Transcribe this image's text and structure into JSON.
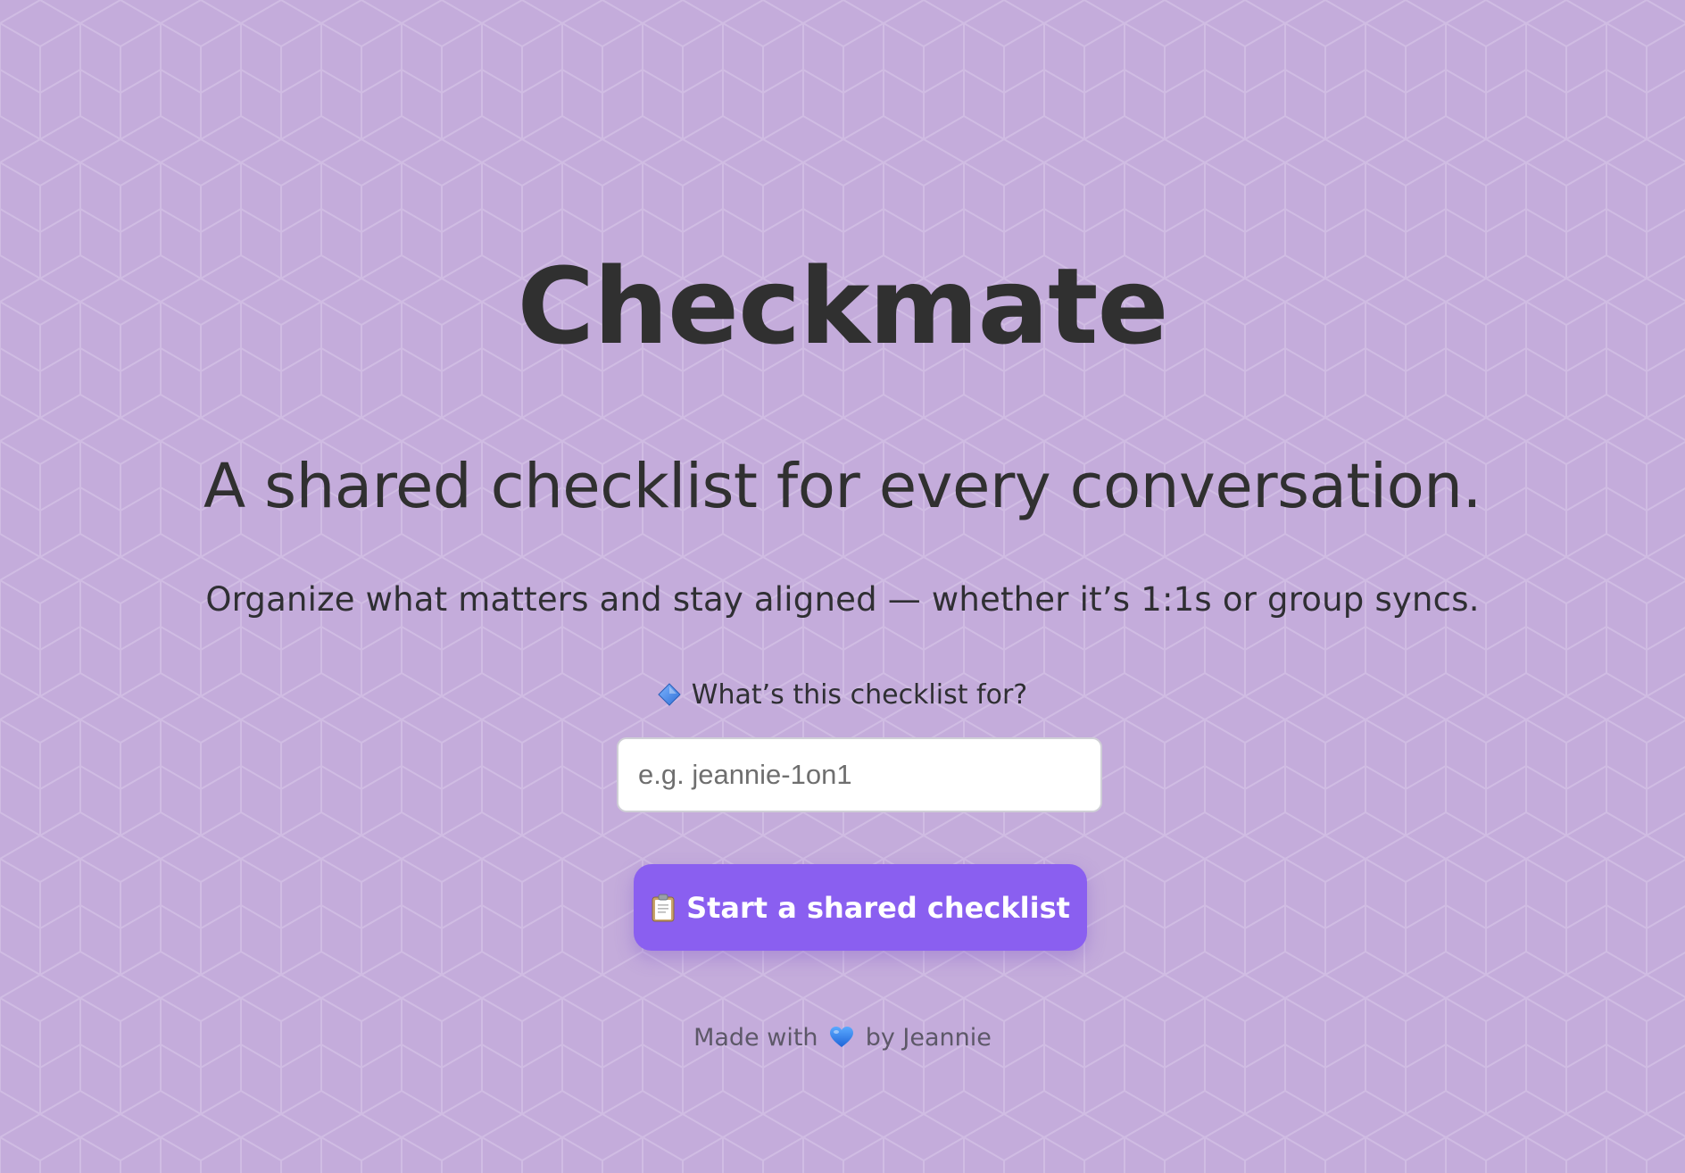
{
  "brand": {
    "title": "Checkmate"
  },
  "hero": {
    "tagline": "A shared checklist for every conversation.",
    "description": "Organize what matters and stay aligned — whether it’s 1:1s or group syncs."
  },
  "form": {
    "prompt_label": "What’s this checklist for?",
    "prompt_icon": "blue-diamond-icon",
    "input_value": "",
    "input_placeholder": "e.g. jeannie-1on1",
    "start_button_label": "Start a shared checklist",
    "start_button_icon": "clipboard-icon"
  },
  "footer": {
    "made_with": "Made with",
    "heart_icon": "blue-heart-icon",
    "by_text": "by Jeannie"
  },
  "colors": {
    "background": "#c4acdb",
    "accent": "#8a5ff0",
    "text": "#303030"
  }
}
